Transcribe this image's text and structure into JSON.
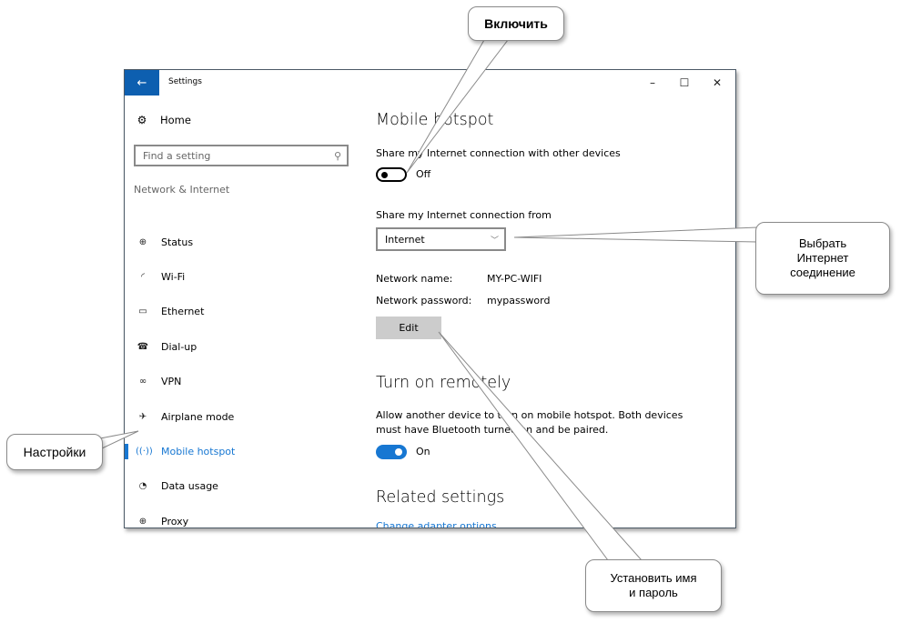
{
  "window": {
    "title": "Settings",
    "controls": {
      "minimize": "–",
      "maximize": "☐",
      "close": "✕"
    }
  },
  "sidebar": {
    "home_label": "Home",
    "search_placeholder": "Find a setting",
    "group_title": "Network & Internet",
    "items": [
      {
        "label": "Status",
        "icon": "status-globe-icon",
        "glyph": "⊕",
        "active": false
      },
      {
        "label": "Wi-Fi",
        "icon": "wifi-icon",
        "glyph": "◜",
        "active": false
      },
      {
        "label": "Ethernet",
        "icon": "ethernet-icon",
        "glyph": "▭",
        "active": false
      },
      {
        "label": "Dial-up",
        "icon": "dialup-icon",
        "glyph": "☎",
        "active": false
      },
      {
        "label": "VPN",
        "icon": "vpn-icon",
        "glyph": "∞",
        "active": false
      },
      {
        "label": "Airplane mode",
        "icon": "airplane-icon",
        "glyph": "✈",
        "active": false
      },
      {
        "label": "Mobile hotspot",
        "icon": "hotspot-icon",
        "glyph": "((·))",
        "active": true
      },
      {
        "label": "Data usage",
        "icon": "data-usage-icon",
        "glyph": "◔",
        "active": false
      },
      {
        "label": "Proxy",
        "icon": "proxy-globe-icon",
        "glyph": "⊕",
        "active": false
      }
    ]
  },
  "main": {
    "title": "Mobile hotspot",
    "share_label": "Share my Internet connection with other devices",
    "share_toggle": {
      "on": false,
      "state_label": "Off"
    },
    "share_from_label": "Share my Internet connection from",
    "share_from_value": "Internet",
    "network_name_label": "Network name:",
    "network_name_value": "MY-PC-WIFI",
    "network_password_label": "Network password:",
    "network_password_value": "mypassword",
    "edit_label": "Edit",
    "remote_title": "Turn on remotely",
    "remote_desc": "Allow another device to turn on mobile hotspot. Both devices must have Bluetooth turned on and be paired.",
    "remote_toggle": {
      "on": true,
      "state_label": "On"
    },
    "related_title": "Related settings",
    "related_link": "Change adapter options"
  },
  "callouts": {
    "enable": "Включить",
    "choose_connection": "Выбрать\nИнтернет\nсоединение",
    "settings": "Настройки",
    "set_name_password": "Установить имя\nи пароль"
  },
  "colors": {
    "accent": "#1777d2",
    "back_button": "#0d5fb0",
    "edit_button": "#cccccc"
  }
}
